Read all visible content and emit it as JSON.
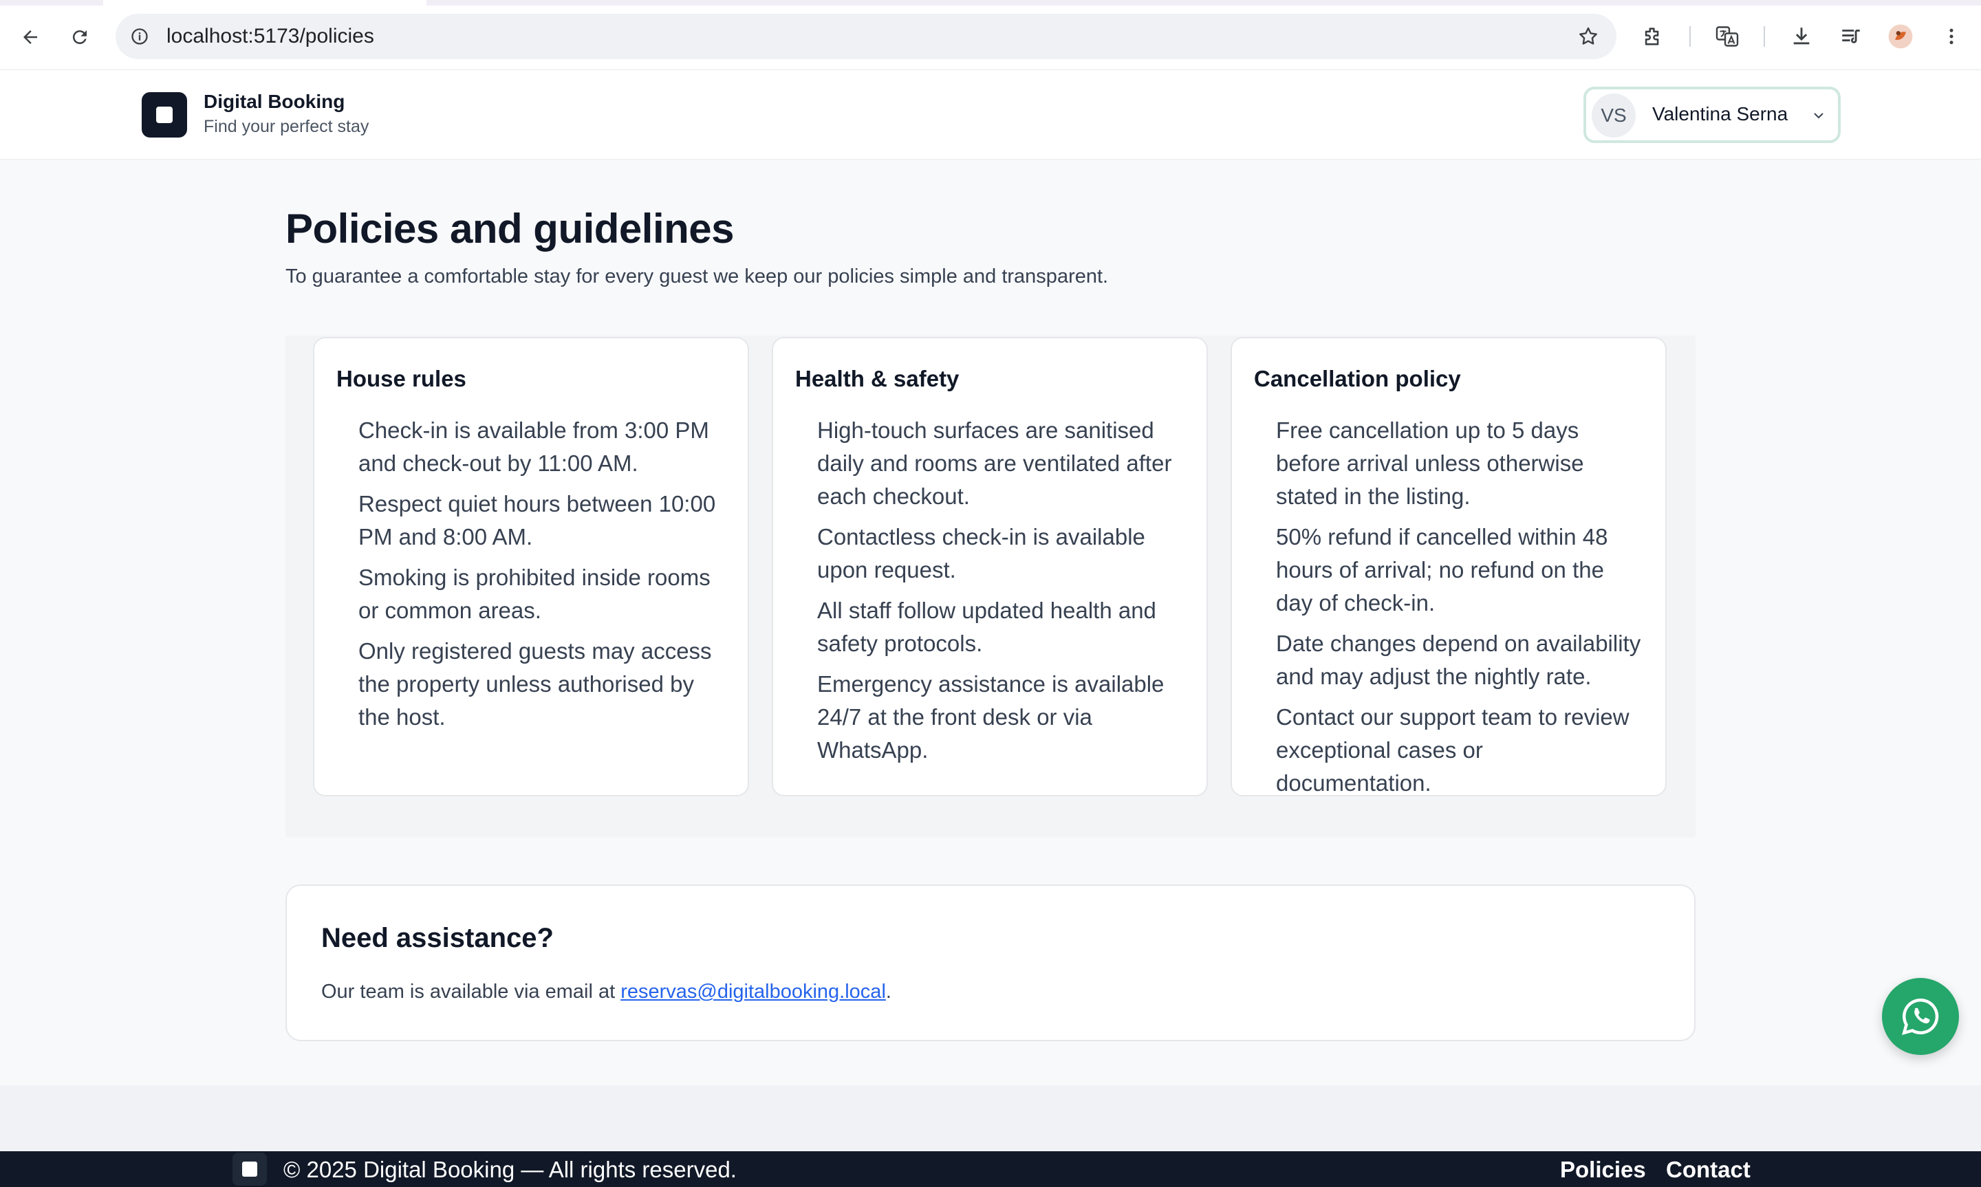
{
  "browser": {
    "url": "localhost:5173/policies"
  },
  "header": {
    "brand_name": "Digital Booking",
    "brand_tagline": "Find your perfect stay",
    "user_initials": "VS",
    "user_name": "Valentina Serna"
  },
  "main": {
    "title": "Policies and guidelines",
    "subtitle": "To guarantee a comfortable stay for every guest we keep our policies simple and transparent.",
    "cards": [
      {
        "title": "House rules",
        "items": [
          "Check-in is available from 3:00 PM and check-out by 11:00 AM.",
          "Respect quiet hours between 10:00 PM and 8:00 AM.",
          "Smoking is prohibited inside rooms or common areas.",
          "Only registered guests may access the property unless authorised by the host."
        ]
      },
      {
        "title": "Health & safety",
        "items": [
          "High-touch surfaces are sanitised daily and rooms are ventilated after each checkout.",
          "Contactless check-in is available upon request.",
          "All staff follow updated health and safety protocols.",
          "Emergency assistance is available 24/7 at the front desk or via WhatsApp."
        ]
      },
      {
        "title": "Cancellation policy",
        "items": [
          "Free cancellation up to 5 days before arrival unless otherwise stated in the listing.",
          "50% refund if cancelled within 48 hours of arrival; no refund on the day of check-in.",
          "Date changes depend on availability and may adjust the nightly rate.",
          "Contact our support team to review exceptional cases or documentation."
        ]
      }
    ],
    "assistance": {
      "title": "Need assistance?",
      "text_before": "Our team is available via email at ",
      "email": "reservas@digitalbooking.local",
      "text_after": "."
    }
  },
  "footer": {
    "copyright": "© 2025 Digital Booking — All rights reserved.",
    "links": [
      "Policies",
      "Contact"
    ]
  },
  "colors": {
    "brand_dark": "#111827",
    "link": "#2563eb",
    "whatsapp": "#25a66a"
  }
}
